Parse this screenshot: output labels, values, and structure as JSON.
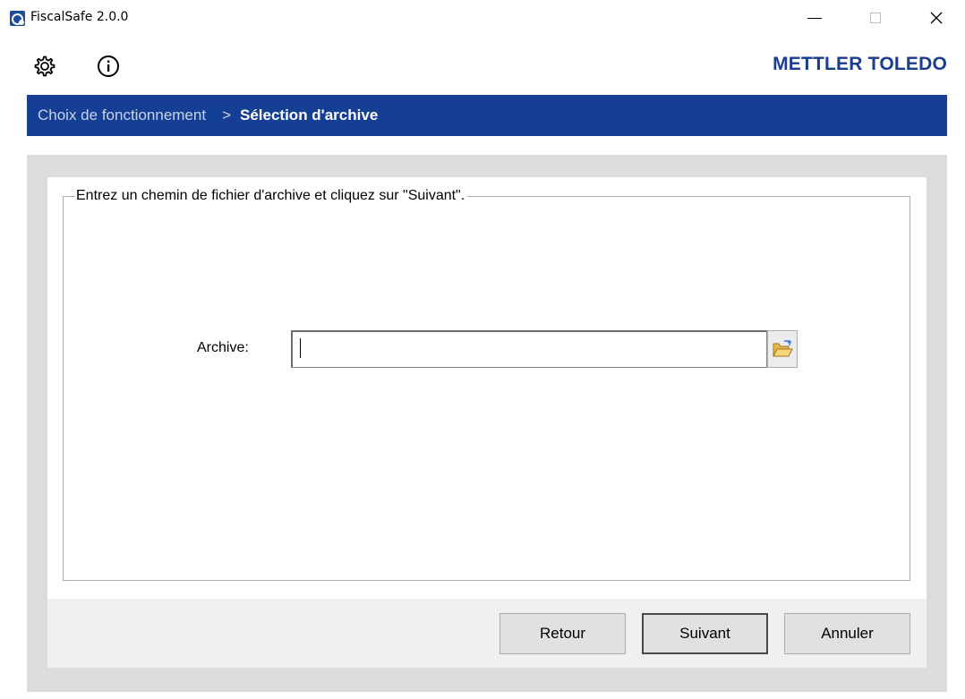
{
  "window": {
    "title": "FiscalSafe 2.0.0",
    "icons": {
      "app": "fiscalsafe-app-icon",
      "minimize": "minimize-icon",
      "maximize": "maximize-icon",
      "close": "close-icon"
    },
    "close_glyph": "✕"
  },
  "toolbar": {
    "settings_icon": "gear-icon",
    "info_icon": "info-icon",
    "brand": "METTLER TOLEDO"
  },
  "breadcrumb": {
    "step1": "Choix de fonctionnement",
    "separator": ">",
    "step2": "Sélection d'archive"
  },
  "form": {
    "instruction": "Entrez un chemin de fichier d'archive et cliquez sur \"Suivant\".",
    "archive_label": "Archive:",
    "archive_value": "",
    "browse_icon": "folder-open-icon"
  },
  "buttons": {
    "back": "Retour",
    "next": "Suivant",
    "cancel": "Annuler"
  },
  "colors": {
    "header_bar": "#153f94",
    "brand": "#1a3d8f",
    "frame": "#dcdcdc"
  }
}
